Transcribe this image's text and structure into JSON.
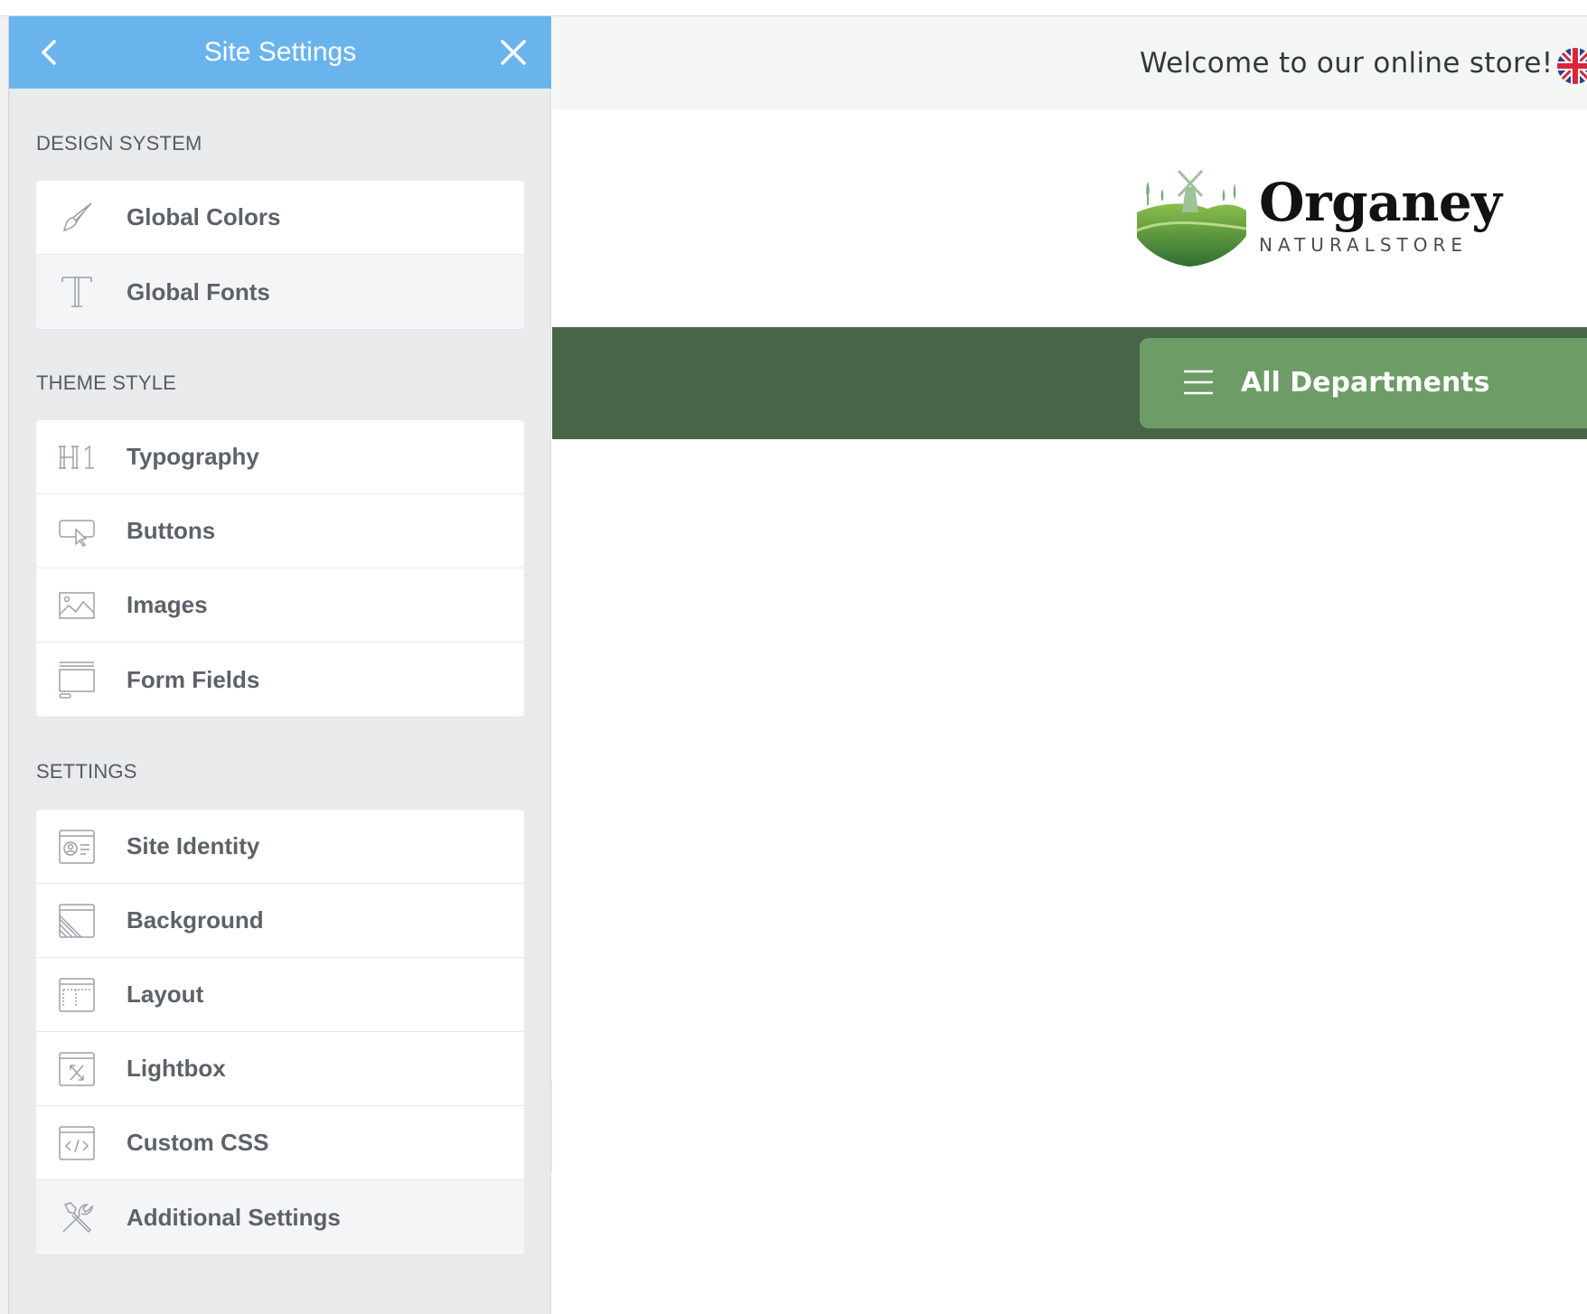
{
  "panel": {
    "title": "Site Settings",
    "sections": [
      {
        "title": "DESIGN SYSTEM",
        "items": [
          {
            "label": "Global Colors",
            "icon": "brush-icon"
          },
          {
            "label": "Global Fonts",
            "icon": "text-t-icon"
          }
        ]
      },
      {
        "title": "THEME STYLE",
        "items": [
          {
            "label": "Typography",
            "icon": "h1-icon"
          },
          {
            "label": "Buttons",
            "icon": "button-cursor-icon"
          },
          {
            "label": "Images",
            "icon": "image-icon"
          },
          {
            "label": "Form Fields",
            "icon": "form-field-icon"
          }
        ]
      },
      {
        "title": "SETTINGS",
        "items": [
          {
            "label": "Site Identity",
            "icon": "id-card-icon"
          },
          {
            "label": "Background",
            "icon": "background-icon"
          },
          {
            "label": "Layout",
            "icon": "layout-icon"
          },
          {
            "label": "Lightbox",
            "icon": "lightbox-icon"
          },
          {
            "label": "Custom CSS",
            "icon": "code-icon"
          },
          {
            "label": "Additional Settings",
            "icon": "tools-icon"
          }
        ]
      }
    ]
  },
  "site": {
    "welcome": "Welcome to our online store!",
    "brand": "Organey",
    "tagline": "NATURALSTORE",
    "departments": "All Departments"
  },
  "colors": {
    "panel_header": "#6ab4ee",
    "nav_green": "#486549",
    "dept_green": "#6e9c67"
  }
}
